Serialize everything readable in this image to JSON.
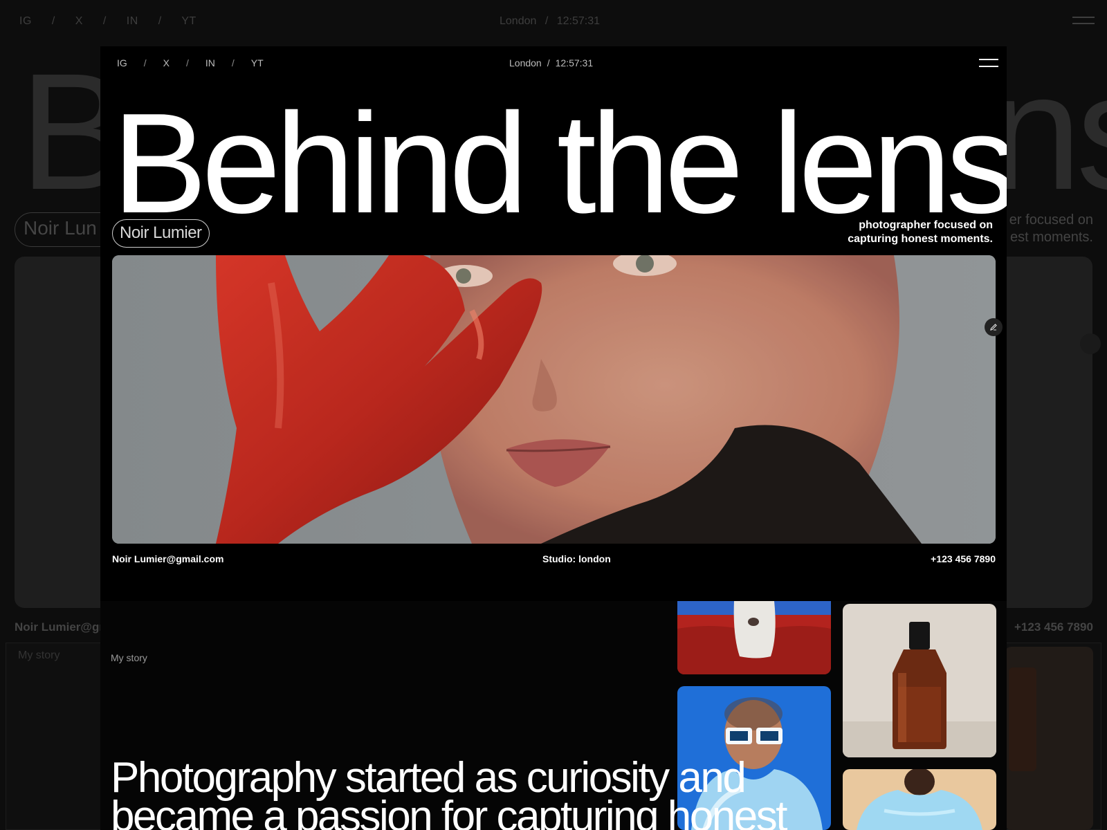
{
  "nav": {
    "social": [
      "IG",
      "X",
      "IN",
      "YT"
    ],
    "separator": "/",
    "city": "London",
    "time": "12:57:31"
  },
  "hero": {
    "headline": "Behind the lens",
    "name": "Noir Lumier",
    "tagline_line1": "photographer focused on",
    "tagline_line2": "capturing honest moments."
  },
  "contact": {
    "email": "Noir Lumier@gmail.com",
    "studio": "Studio: london",
    "phone": "+123 456 7890"
  },
  "story": {
    "label": "My story",
    "text": "Photography started as curiosity and became a passion for capturing honest"
  },
  "background": {
    "headline_start": "B",
    "headline_end": "ns",
    "name_fragment": "Noir Lun",
    "tagline_fragment_1": "er focused on",
    "tagline_fragment_2": "est moments.",
    "email_fragment": "Noir Lumier@gm",
    "phone": "+123 456 7890",
    "story_label": "My story"
  },
  "colors": {
    "background": "#000000",
    "text": "#ffffff",
    "muted": "#bdbdbd",
    "glove_red": "#c42a1f"
  }
}
